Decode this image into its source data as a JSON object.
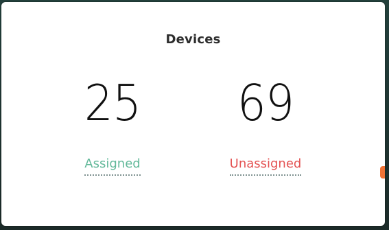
{
  "card": {
    "title": "Devices",
    "metrics": [
      {
        "value": "25",
        "label": "Assigned",
        "color": "#63b99a"
      },
      {
        "value": "69",
        "label": "Unassigned",
        "color": "#e45353"
      }
    ]
  },
  "theme": {
    "background": "#20302e",
    "card_background": "#ffffff",
    "accent_edge": "#f06c2a"
  }
}
